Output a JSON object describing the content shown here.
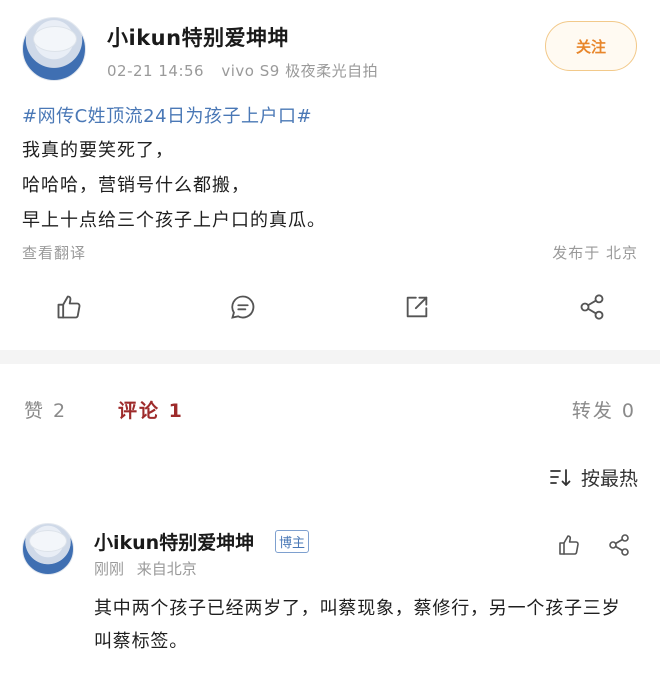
{
  "post": {
    "username": "小ikun特别爱坤坤",
    "date": "02-21 14:56",
    "device": "vivo S9 极夜柔光自拍",
    "follow_label": "关注",
    "hashtag": "#网传C姓顶流24日为孩子上户口#",
    "lines": [
      "我真的要笑死了，",
      "哈哈哈，营销号什么都搬，",
      "早上十点给三个孩子上户口的真瓜。"
    ],
    "translate_label": "查看翻译",
    "location_label": "发布于 北京",
    "actions": [
      {
        "name": "like",
        "icon": "thumbs-up-icon"
      },
      {
        "name": "comment",
        "icon": "comment-icon"
      },
      {
        "name": "repost",
        "icon": "repost-icon"
      },
      {
        "name": "share",
        "icon": "share-icon"
      }
    ]
  },
  "tabs": {
    "like": "赞 2",
    "comment": "评论 1",
    "repost": "转发 0"
  },
  "sort": {
    "label": "按最热"
  },
  "comment": {
    "username": "小ikun特别爱坤坤",
    "badge": "博主",
    "time": "刚刚",
    "location": "来自北京",
    "lines": [
      "其中两个孩子已经两岁了，叫蔡现象，蔡修行，另一个孩子三岁",
      "叫蔡标签。"
    ]
  },
  "colors": {
    "accent": "#9e2b2b",
    "link": "#4a78b6",
    "follow": "#e8862b",
    "muted": "#9a9a9a"
  }
}
